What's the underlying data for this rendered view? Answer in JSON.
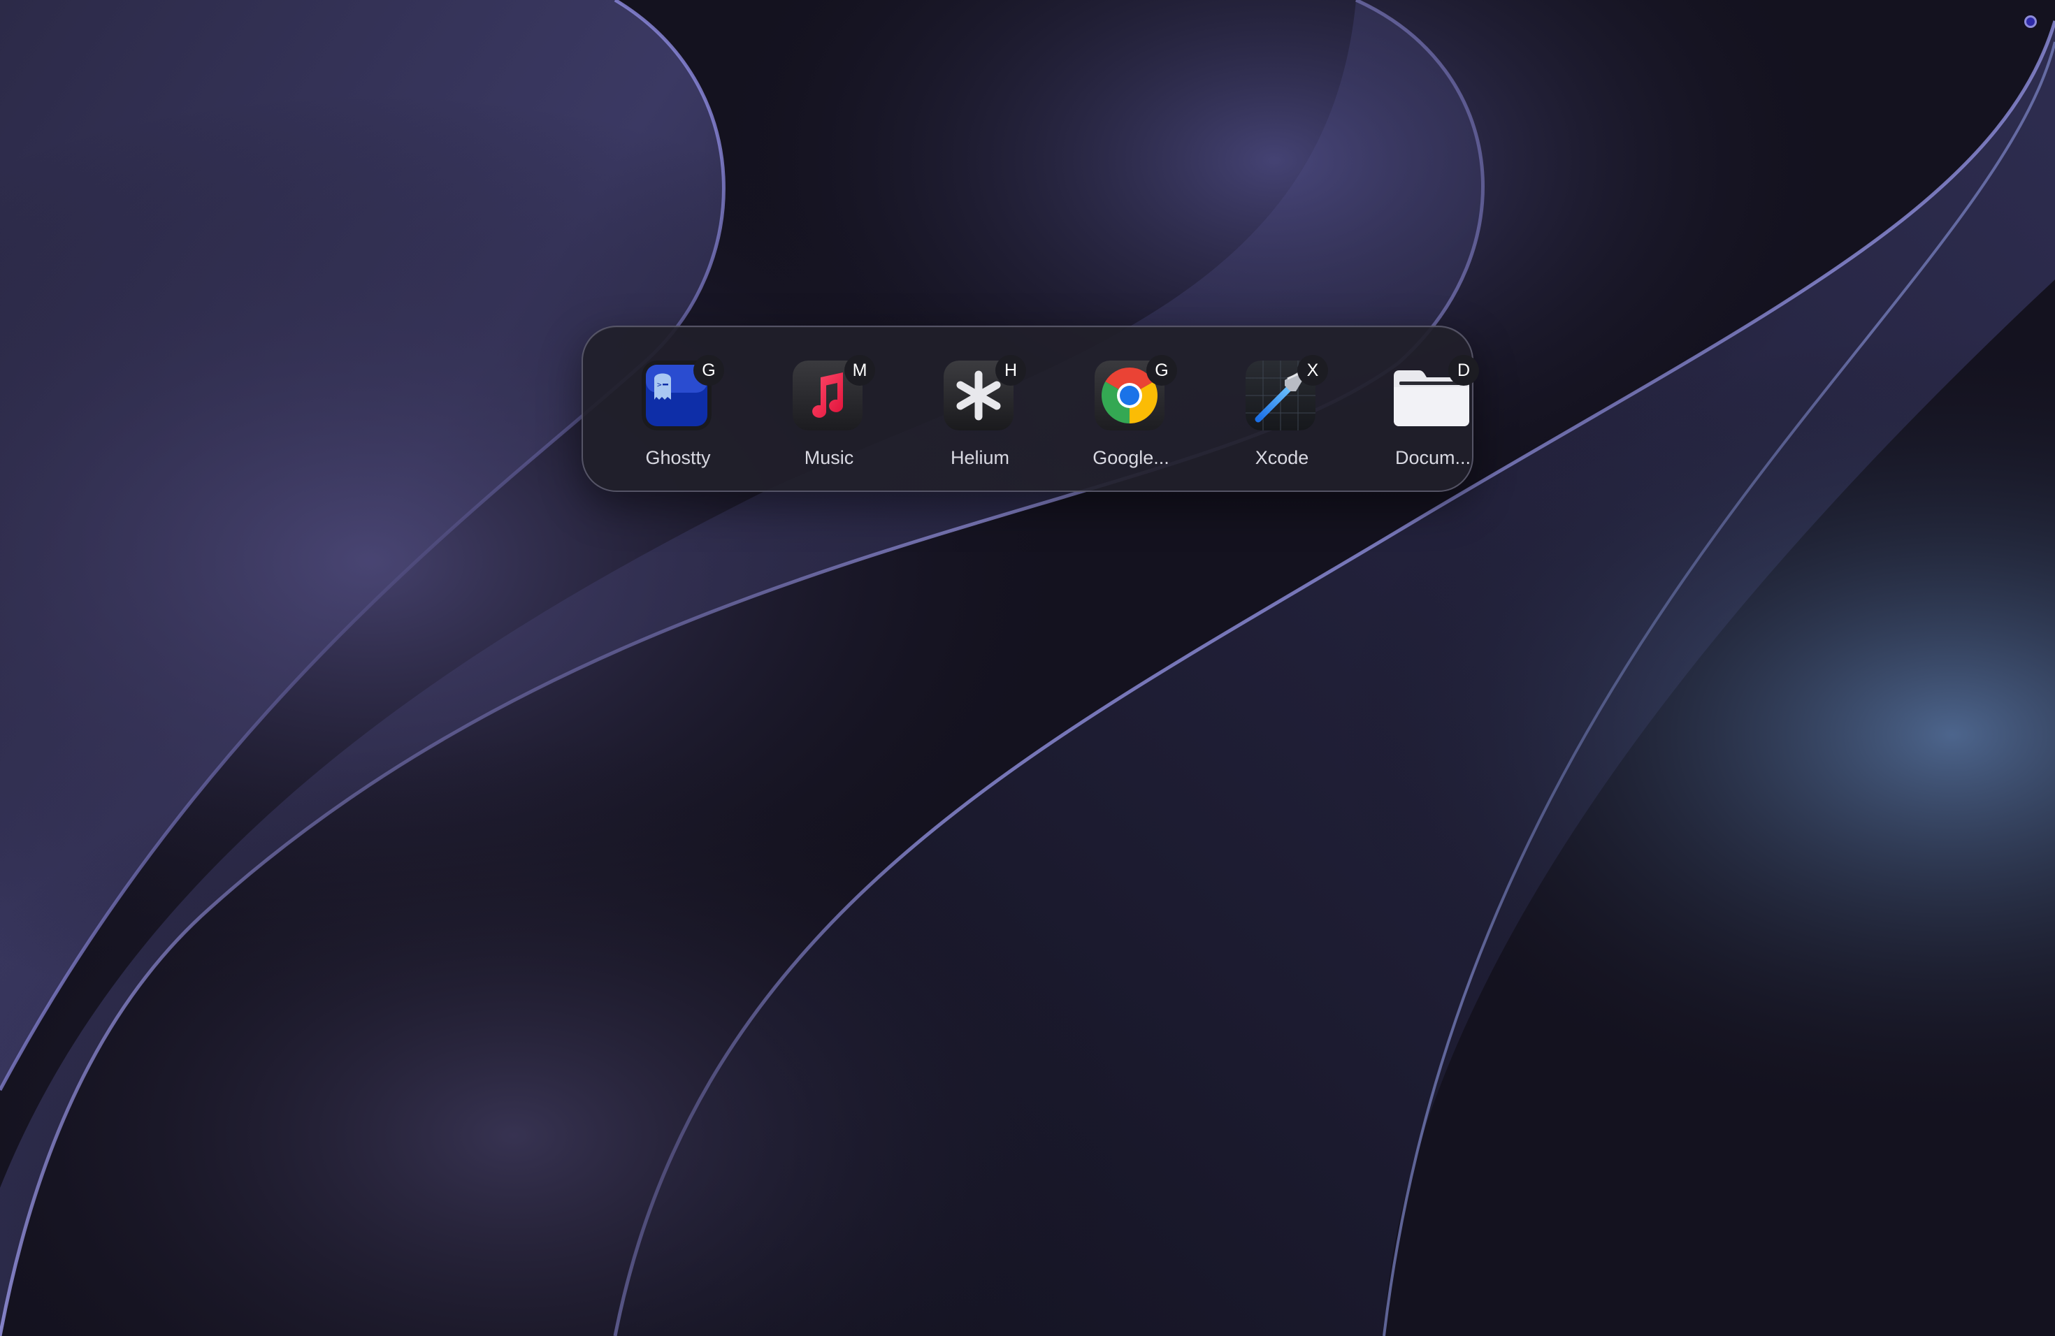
{
  "colors": {
    "wallpaper_base": "#14121f",
    "wallpaper_ribbon": "#4a4878",
    "wallpaper_edge": "#9a98e8",
    "switcher_background": "#201f2a",
    "badge_background": "#1c1c22",
    "label_text": "#d9d9e2",
    "status_dot": "#2e2aa8"
  },
  "menu_bar": {
    "status_indicator_icon": "status-dot-icon"
  },
  "app_switcher": {
    "apps": [
      {
        "label": "Ghostty",
        "shortcut": "G",
        "icon": "ghostty-icon"
      },
      {
        "label": "Music",
        "shortcut": "M",
        "icon": "music-icon"
      },
      {
        "label": "Helium",
        "shortcut": "H",
        "icon": "helium-icon"
      },
      {
        "label": "Google...",
        "shortcut": "G",
        "icon": "chrome-icon"
      },
      {
        "label": "Xcode",
        "shortcut": "X",
        "icon": "xcode-icon"
      },
      {
        "label": "Docum...",
        "shortcut": "D",
        "icon": "folder-icon"
      }
    ]
  }
}
